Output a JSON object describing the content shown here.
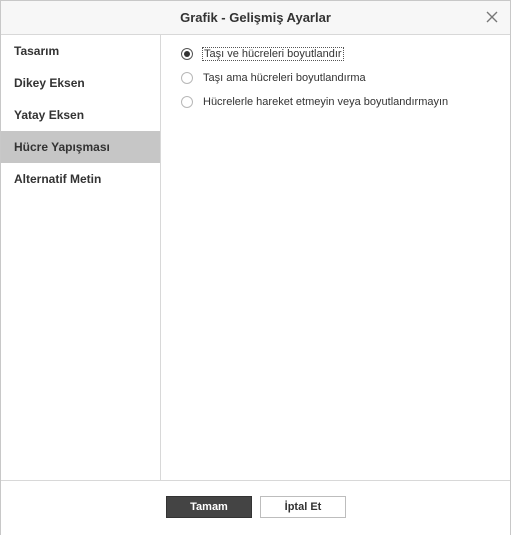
{
  "dialog": {
    "title": "Grafik - Gelişmiş Ayarlar",
    "close_icon": "close-icon"
  },
  "sidebar": {
    "items": [
      {
        "label": "Tasarım",
        "active": false
      },
      {
        "label": "Dikey Eksen",
        "active": false
      },
      {
        "label": "Yatay Eksen",
        "active": false
      },
      {
        "label": "Hücre Yapışması",
        "active": true
      },
      {
        "label": "Alternatif Metin",
        "active": false
      }
    ]
  },
  "options": {
    "items": [
      {
        "label": "Taşı ve hücreleri boyutlandır",
        "checked": true
      },
      {
        "label": "Taşı ama hücreleri boyutlandırma",
        "checked": false
      },
      {
        "label": "Hücrelerle hareket etmeyin veya boyutlandırmayın",
        "checked": false
      }
    ]
  },
  "footer": {
    "ok_label": "Tamam",
    "cancel_label": "İptal Et"
  },
  "colors": {
    "active_sidebar_bg": "#c6c6c6",
    "primary_button_bg": "#444444"
  }
}
